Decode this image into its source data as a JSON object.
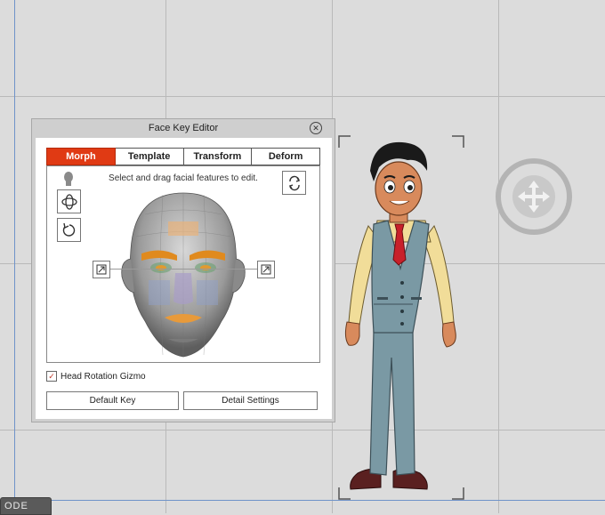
{
  "panel": {
    "title": "Face Key Editor",
    "tabs": [
      {
        "label": "Morph",
        "active": true
      },
      {
        "label": "Template",
        "active": false
      },
      {
        "label": "Transform",
        "active": false
      },
      {
        "label": "Deform",
        "active": false
      }
    ],
    "hint": "Select and drag facial features to edit.",
    "head_rotation_gizmo": {
      "label": "Head Rotation Gizmo",
      "checked": true
    },
    "default_key_label": "Default Key",
    "detail_settings_label": "Detail Settings"
  },
  "bottom_tab": {
    "label": "ODE"
  },
  "colors": {
    "accent": "#e03a14",
    "axis": "#6f93c9"
  }
}
